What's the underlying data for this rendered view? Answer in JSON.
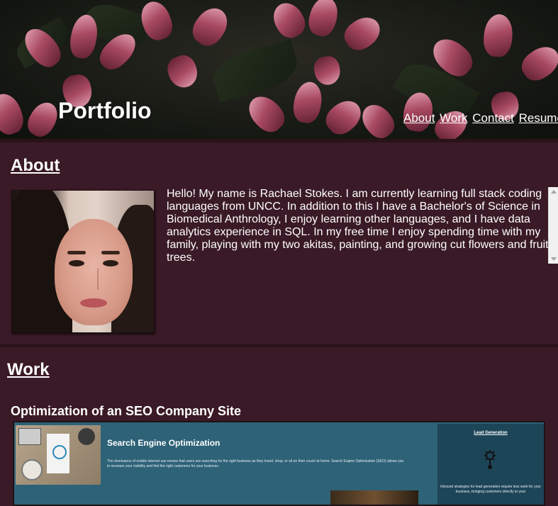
{
  "header": {
    "title": "Portfolio",
    "nav": [
      {
        "label": "About"
      },
      {
        "label": "Work"
      },
      {
        "label": "Contact"
      },
      {
        "label": "Resume"
      }
    ]
  },
  "about": {
    "heading": "About",
    "photo_alt": "profile-photo",
    "bio": "Hello! My name is Rachael Stokes. I am currently learning full stack coding languages from UNCC. In addition to this I have a Bachelor's of Science in Biomedical Anthrology, I enjoy learning other languages, and I have data analytics experience in SQL. In my free time I enjoy spending time with my family, playing with my two akitas, painting, and growing cut flowers and fruit trees."
  },
  "work": {
    "heading": "Work",
    "projects": [
      {
        "title": "Optimization of an SEO Company Site",
        "preview": {
          "section_title": "Search Engine Optimization",
          "section_body": "The dominance of mobile internet use means that users are searching for the right business as they travel, shop, or sit on their couch at home. Search Engine Optimization (SEO) allows you to increase your visibility and find the right customers for your business.",
          "sidebar_title": "Lead Generation",
          "sidebar_body": "Inbound strategies for lead generation require less work for your business, bringing customers directly to your"
        }
      }
    ]
  },
  "colors": {
    "page_bg": "#3a1a26",
    "divider": "#2a1219",
    "text": "#ffffff",
    "preview_bg": "#2d6277",
    "preview_sidebar": "#1d4558"
  }
}
